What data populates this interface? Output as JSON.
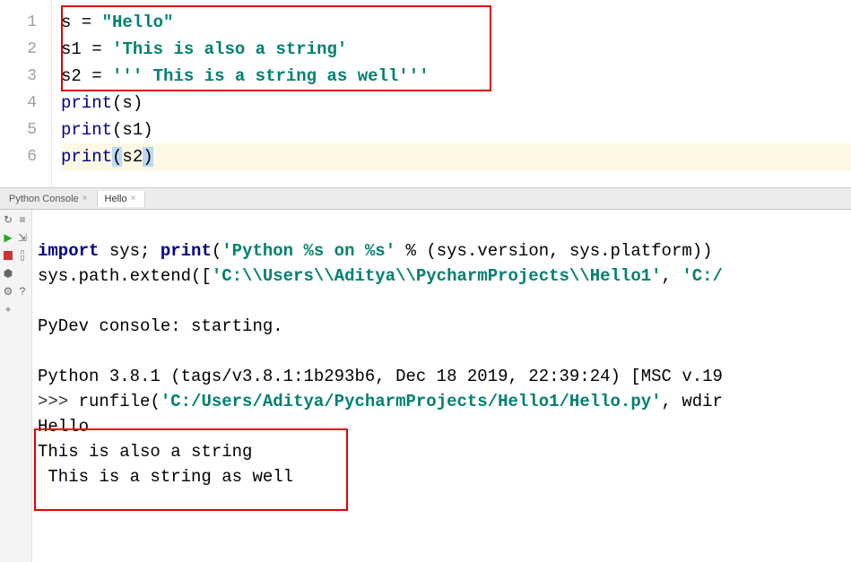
{
  "gutter": [
    "1",
    "2",
    "3",
    "4",
    "5",
    "6"
  ],
  "code": {
    "l1": {
      "var": "s",
      "eq": " = ",
      "q1": "\"",
      "body": "Hello",
      "q2": "\""
    },
    "l2": {
      "var": "s1",
      "eq": " = ",
      "q1": "'",
      "body": "This is also a string",
      "q2": "'"
    },
    "l3": {
      "var": "s2",
      "eq": " = ",
      "q1": "'''",
      "body": " This is a string as well",
      "q2": "'''"
    },
    "l4": {
      "fn": "print",
      "lp": "(",
      "arg": "s",
      "rp": ")"
    },
    "l5": {
      "fn": "print",
      "lp": "(",
      "arg": "s1",
      "rp": ")"
    },
    "l6": {
      "fn": "print",
      "lp": "(",
      "arg": "s2",
      "rp": ")"
    }
  },
  "tabs": {
    "console": "Python Console",
    "file": "Hello",
    "close_glyph": "×"
  },
  "console": {
    "import_kw": "import",
    "import_rest": " sys; ",
    "print1_fn": "print",
    "print1_open": "(",
    "print1_str": "'Python %s on %s'",
    "print1_mid": " % (sys.version, sys.platform))",
    "path1": "sys.path.extend([",
    "path1_str": "'C:\\\\Users\\\\Aditya\\\\PycharmProjects\\\\Hello1'",
    "path1_tail": ", ",
    "path1_str2": "'C:/",
    "blank": "",
    "pydev": "PyDev console: starting.",
    "pyver": "Python 3.8.1 (tags/v3.8.1:1b293b6, Dec 18 2019, 22:39:24) [MSC v.19",
    "prompt": ">>> ",
    "run_fn": "runfile",
    "run_open": "(",
    "run_str": "'C:/Users/Aditya/PycharmProjects/Hello1/Hello.py'",
    "run_tail": ", wdir",
    "out1": "Hello",
    "out2": "This is also a string",
    "out3": " This is a string as well"
  }
}
